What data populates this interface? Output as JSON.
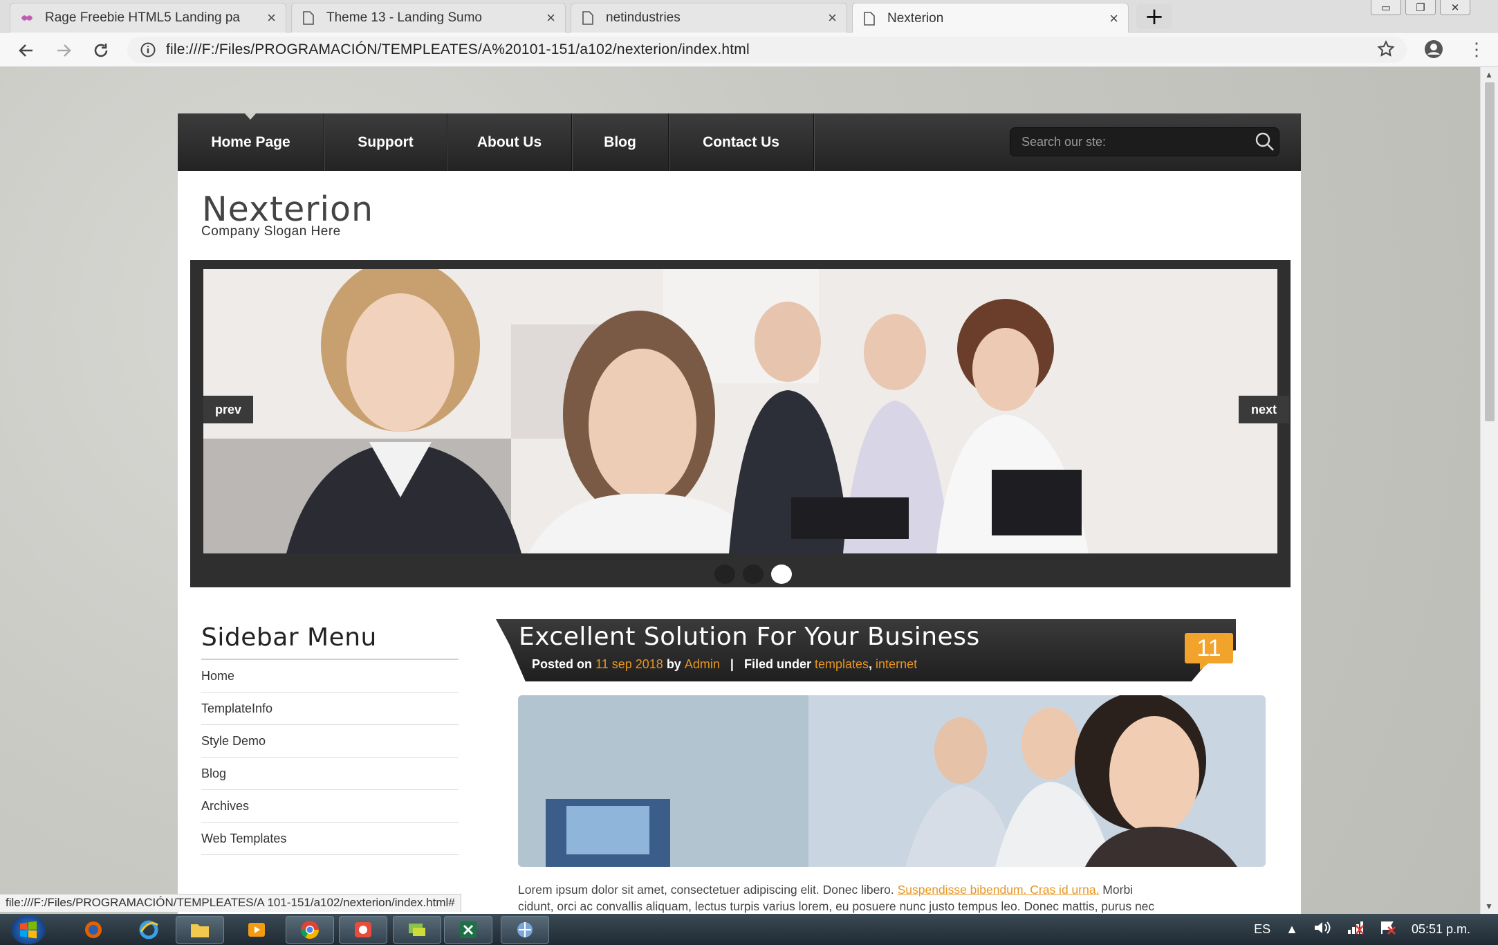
{
  "browser": {
    "tabs": [
      {
        "title": "Rage Freebie HTML5 Landing pa",
        "active": false
      },
      {
        "title": "Theme 13 - Landing Sumo",
        "active": false
      },
      {
        "title": "netindustries",
        "active": false
      },
      {
        "title": "Nexterion",
        "active": true
      }
    ],
    "new_tab_label": "+",
    "window_controls": [
      "minimize",
      "restore",
      "close"
    ],
    "url": "file:///F:/Files/PROGRAMACIÓN/TEMPLEATES/A%20101-151/a102/nexterion/index.html",
    "status_url": "file:///F:/Files/PROGRAMACIÓN/TEMPLEATES/A 101-151/a102/nexterion/index.html#"
  },
  "site": {
    "nav": [
      {
        "label": "Home Page"
      },
      {
        "label": "Support"
      },
      {
        "label": "About Us"
      },
      {
        "label": "Blog"
      },
      {
        "label": "Contact Us"
      }
    ],
    "search_placeholder": "Search our ste:",
    "brand": "Nexterion",
    "slogan": "Company Slogan Here",
    "slider": {
      "prev_label": "prev",
      "next_label": "next",
      "dots_count": 3,
      "active_dot": 3
    },
    "sidebar": {
      "title": "Sidebar Menu",
      "items": [
        "Home",
        "TemplateInfo",
        "Style Demo",
        "Blog",
        "Archives",
        "Web Templates"
      ]
    },
    "post": {
      "title": "Excellent Solution For Your Business",
      "posted_on_label": "Posted on",
      "date": "11 sep 2018",
      "by_label": "by",
      "author": "Admin",
      "filed_label": "Filed under",
      "categories": [
        "templates",
        "internet"
      ],
      "comments": "11",
      "body_line1_a": "Lorem ipsum dolor sit amet, consectetuer adipiscing elit. Donec libero. ",
      "body_link": "Suspendisse bibendum. Cras id urna.",
      "body_line1_b": " Morbi",
      "body_line2": "cidunt, orci ac convallis aliquam, lectus turpis varius lorem, eu posuere nunc justo tempus leo. Donec mattis, purus nec"
    }
  },
  "taskbar": {
    "language": "ES",
    "clock": "05:51 p.m."
  },
  "colors": {
    "accent": "#e8951f",
    "badge": "#f2a32b",
    "nav_dark": "#2a2a2a"
  }
}
